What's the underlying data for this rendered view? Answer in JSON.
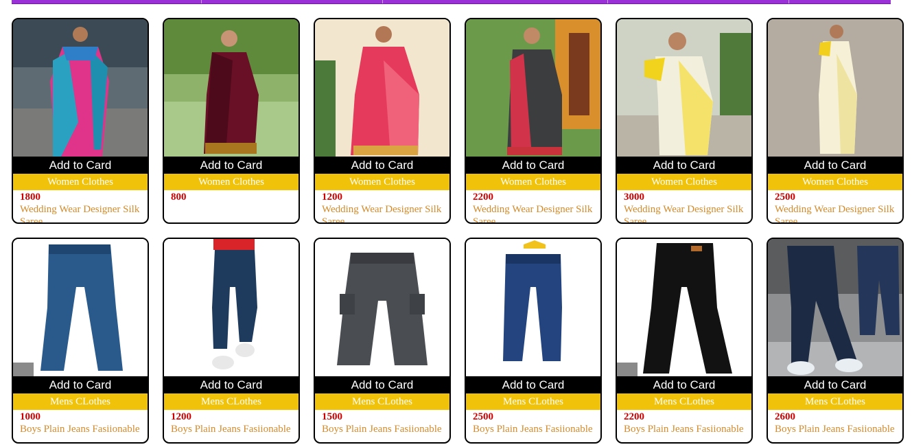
{
  "nav": {
    "accent": "#9b30d9"
  },
  "colors": {
    "button_bg": "#000000",
    "category_bg": "#f0c20a",
    "price": "#cc0000",
    "name": "#d48a2a"
  },
  "products": [
    {
      "image": "saree-pink-blue-photo",
      "button": "Add to Card",
      "category": "Women Clothes",
      "price": "1800",
      "name": "Wedding Wear Designer Silk Saree"
    },
    {
      "image": "saree-maroon-photo",
      "button": "Add to Card",
      "category": "Women Clothes",
      "price": "800",
      "name": ""
    },
    {
      "image": "saree-red-photo",
      "button": "Add to Card",
      "category": "Women Clothes",
      "price": "1200",
      "name": "Wedding Wear Designer Silk Saree"
    },
    {
      "image": "saree-black-red-photo",
      "button": "Add to Card",
      "category": "Women Clothes",
      "price": "2200",
      "name": "Wedding Wear Designer Silk Saree"
    },
    {
      "image": "saree-cream-yellow-photo",
      "button": "Add to Card",
      "category": "Women Clothes",
      "price": "3000",
      "name": "Wedding Wear Designer Silk Saree"
    },
    {
      "image": "saree-off-white-photo",
      "button": "Add to Card",
      "category": "Women Clothes",
      "price": "2500",
      "name": "Wedding Wear Designer Silk Saree"
    },
    {
      "image": "jeans-blue-photo",
      "button": "Add to Card",
      "category": "Mens CLothes",
      "price": "1000",
      "name": "Boys Plain Jeans Fasiionable"
    },
    {
      "image": "jeans-boy-model-photo",
      "button": "Add to Card",
      "category": "Mens CLothes",
      "price": "1200",
      "name": "Boys Plain Jeans Fasiionable"
    },
    {
      "image": "jeans-grey-cargo-photo",
      "button": "Add to Card",
      "category": "Mens CLothes",
      "price": "1500",
      "name": "Boys Plain Jeans Fasiionable"
    },
    {
      "image": "jeans-blue-hanger-photo",
      "button": "Add to Card",
      "category": "Mens CLothes",
      "price": "2500",
      "name": "Boys Plain Jeans Fasiionable"
    },
    {
      "image": "jeans-black-photo",
      "button": "Add to Card",
      "category": "Mens CLothes",
      "price": "2200",
      "name": "Boys Plain Jeans Fasiionable"
    },
    {
      "image": "jeans-street-model-photo",
      "button": "Add to Card",
      "category": "Mens CLothes",
      "price": "2600",
      "name": "Boys Plain Jeans Fasiionable"
    }
  ]
}
